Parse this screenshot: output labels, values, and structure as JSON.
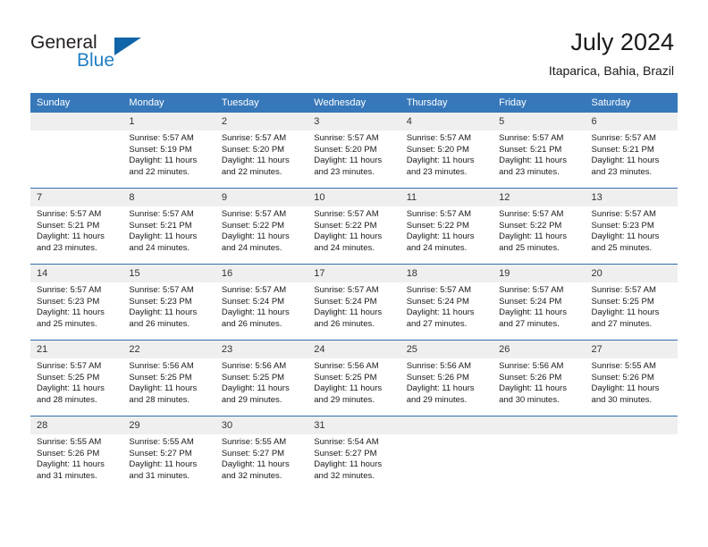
{
  "brand": {
    "name_part1": "General",
    "name_part2": "Blue",
    "triangle_color": "#1164a8",
    "blue_color": "#1f7fc4"
  },
  "header": {
    "title": "July 2024",
    "subtitle": "Itaparica, Bahia, Brazil"
  },
  "theme": {
    "header_row_background": "#3778ba",
    "header_row_text": "#ffffff",
    "daynum_background": "#efefef",
    "row_divider": "#2f6fb0"
  },
  "columns": [
    "Sunday",
    "Monday",
    "Tuesday",
    "Wednesday",
    "Thursday",
    "Friday",
    "Saturday"
  ],
  "weeks": [
    [
      {
        "day": "",
        "lines": []
      },
      {
        "day": "1",
        "lines": [
          "Sunrise: 5:57 AM",
          "Sunset: 5:19 PM",
          "Daylight: 11 hours",
          "and 22 minutes."
        ]
      },
      {
        "day": "2",
        "lines": [
          "Sunrise: 5:57 AM",
          "Sunset: 5:20 PM",
          "Daylight: 11 hours",
          "and 22 minutes."
        ]
      },
      {
        "day": "3",
        "lines": [
          "Sunrise: 5:57 AM",
          "Sunset: 5:20 PM",
          "Daylight: 11 hours",
          "and 23 minutes."
        ]
      },
      {
        "day": "4",
        "lines": [
          "Sunrise: 5:57 AM",
          "Sunset: 5:20 PM",
          "Daylight: 11 hours",
          "and 23 minutes."
        ]
      },
      {
        "day": "5",
        "lines": [
          "Sunrise: 5:57 AM",
          "Sunset: 5:21 PM",
          "Daylight: 11 hours",
          "and 23 minutes."
        ]
      },
      {
        "day": "6",
        "lines": [
          "Sunrise: 5:57 AM",
          "Sunset: 5:21 PM",
          "Daylight: 11 hours",
          "and 23 minutes."
        ]
      }
    ],
    [
      {
        "day": "7",
        "lines": [
          "Sunrise: 5:57 AM",
          "Sunset: 5:21 PM",
          "Daylight: 11 hours",
          "and 23 minutes."
        ]
      },
      {
        "day": "8",
        "lines": [
          "Sunrise: 5:57 AM",
          "Sunset: 5:21 PM",
          "Daylight: 11 hours",
          "and 24 minutes."
        ]
      },
      {
        "day": "9",
        "lines": [
          "Sunrise: 5:57 AM",
          "Sunset: 5:22 PM",
          "Daylight: 11 hours",
          "and 24 minutes."
        ]
      },
      {
        "day": "10",
        "lines": [
          "Sunrise: 5:57 AM",
          "Sunset: 5:22 PM",
          "Daylight: 11 hours",
          "and 24 minutes."
        ]
      },
      {
        "day": "11",
        "lines": [
          "Sunrise: 5:57 AM",
          "Sunset: 5:22 PM",
          "Daylight: 11 hours",
          "and 24 minutes."
        ]
      },
      {
        "day": "12",
        "lines": [
          "Sunrise: 5:57 AM",
          "Sunset: 5:22 PM",
          "Daylight: 11 hours",
          "and 25 minutes."
        ]
      },
      {
        "day": "13",
        "lines": [
          "Sunrise: 5:57 AM",
          "Sunset: 5:23 PM",
          "Daylight: 11 hours",
          "and 25 minutes."
        ]
      }
    ],
    [
      {
        "day": "14",
        "lines": [
          "Sunrise: 5:57 AM",
          "Sunset: 5:23 PM",
          "Daylight: 11 hours",
          "and 25 minutes."
        ]
      },
      {
        "day": "15",
        "lines": [
          "Sunrise: 5:57 AM",
          "Sunset: 5:23 PM",
          "Daylight: 11 hours",
          "and 26 minutes."
        ]
      },
      {
        "day": "16",
        "lines": [
          "Sunrise: 5:57 AM",
          "Sunset: 5:24 PM",
          "Daylight: 11 hours",
          "and 26 minutes."
        ]
      },
      {
        "day": "17",
        "lines": [
          "Sunrise: 5:57 AM",
          "Sunset: 5:24 PM",
          "Daylight: 11 hours",
          "and 26 minutes."
        ]
      },
      {
        "day": "18",
        "lines": [
          "Sunrise: 5:57 AM",
          "Sunset: 5:24 PM",
          "Daylight: 11 hours",
          "and 27 minutes."
        ]
      },
      {
        "day": "19",
        "lines": [
          "Sunrise: 5:57 AM",
          "Sunset: 5:24 PM",
          "Daylight: 11 hours",
          "and 27 minutes."
        ]
      },
      {
        "day": "20",
        "lines": [
          "Sunrise: 5:57 AM",
          "Sunset: 5:25 PM",
          "Daylight: 11 hours",
          "and 27 minutes."
        ]
      }
    ],
    [
      {
        "day": "21",
        "lines": [
          "Sunrise: 5:57 AM",
          "Sunset: 5:25 PM",
          "Daylight: 11 hours",
          "and 28 minutes."
        ]
      },
      {
        "day": "22",
        "lines": [
          "Sunrise: 5:56 AM",
          "Sunset: 5:25 PM",
          "Daylight: 11 hours",
          "and 28 minutes."
        ]
      },
      {
        "day": "23",
        "lines": [
          "Sunrise: 5:56 AM",
          "Sunset: 5:25 PM",
          "Daylight: 11 hours",
          "and 29 minutes."
        ]
      },
      {
        "day": "24",
        "lines": [
          "Sunrise: 5:56 AM",
          "Sunset: 5:25 PM",
          "Daylight: 11 hours",
          "and 29 minutes."
        ]
      },
      {
        "day": "25",
        "lines": [
          "Sunrise: 5:56 AM",
          "Sunset: 5:26 PM",
          "Daylight: 11 hours",
          "and 29 minutes."
        ]
      },
      {
        "day": "26",
        "lines": [
          "Sunrise: 5:56 AM",
          "Sunset: 5:26 PM",
          "Daylight: 11 hours",
          "and 30 minutes."
        ]
      },
      {
        "day": "27",
        "lines": [
          "Sunrise: 5:55 AM",
          "Sunset: 5:26 PM",
          "Daylight: 11 hours",
          "and 30 minutes."
        ]
      }
    ],
    [
      {
        "day": "28",
        "lines": [
          "Sunrise: 5:55 AM",
          "Sunset: 5:26 PM",
          "Daylight: 11 hours",
          "and 31 minutes."
        ]
      },
      {
        "day": "29",
        "lines": [
          "Sunrise: 5:55 AM",
          "Sunset: 5:27 PM",
          "Daylight: 11 hours",
          "and 31 minutes."
        ]
      },
      {
        "day": "30",
        "lines": [
          "Sunrise: 5:55 AM",
          "Sunset: 5:27 PM",
          "Daylight: 11 hours",
          "and 32 minutes."
        ]
      },
      {
        "day": "31",
        "lines": [
          "Sunrise: 5:54 AM",
          "Sunset: 5:27 PM",
          "Daylight: 11 hours",
          "and 32 minutes."
        ]
      },
      {
        "day": "",
        "lines": []
      },
      {
        "day": "",
        "lines": []
      },
      {
        "day": "",
        "lines": []
      }
    ]
  ]
}
